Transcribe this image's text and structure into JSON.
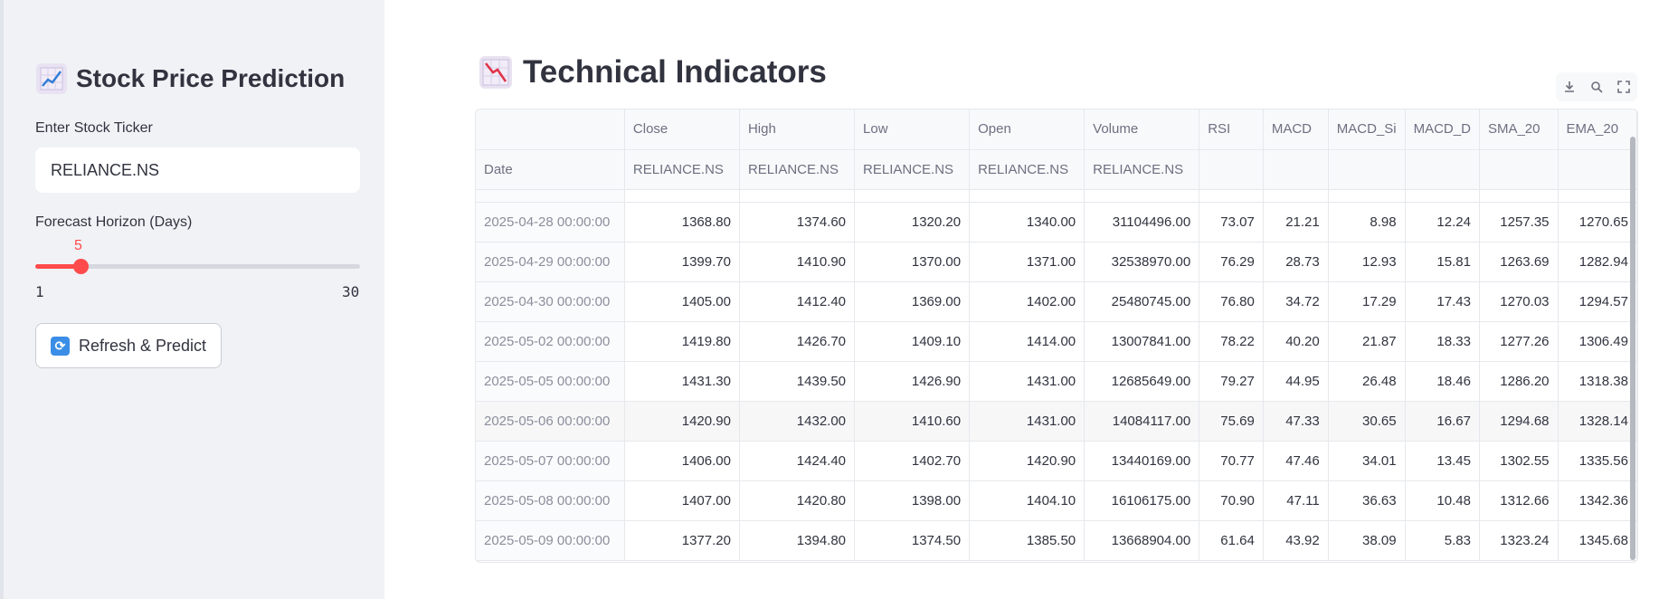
{
  "sidebar": {
    "title": "Stock Price Prediction",
    "title_icon": "chart-increasing-icon",
    "ticker_label": "Enter Stock Ticker",
    "ticker_value": "RELIANCE.NS",
    "horizon_label": "Forecast Horizon (Days)",
    "horizon_value": "5",
    "horizon_fraction": 0.138,
    "horizon_min": "1",
    "horizon_max": "30",
    "refresh_icon": "refresh-arrows-icon",
    "refresh_label": "Refresh & Predict"
  },
  "main": {
    "title": "Technical Indicators",
    "title_icon": "chart-decreasing-icon",
    "toolbar": [
      "download-icon",
      "search-icon",
      "fullscreen-icon"
    ]
  },
  "table": {
    "header_row1": [
      "",
      "Close",
      "High",
      "Low",
      "Open",
      "Volume",
      "RSI",
      "MACD",
      "MACD_Si",
      "MACD_D",
      "SMA_20",
      "EMA_20"
    ],
    "header_row2": [
      "Date",
      "RELIANCE.NS",
      "RELIANCE.NS",
      "RELIANCE.NS",
      "RELIANCE.NS",
      "RELIANCE.NS",
      "",
      "",
      "",
      "",
      "",
      ""
    ],
    "rows": [
      [
        "2025-04-28 00:00:00",
        "1368.80",
        "1374.60",
        "1320.20",
        "1340.00",
        "31104496.00",
        "73.07",
        "21.21",
        "8.98",
        "12.24",
        "1257.35",
        "1270.65"
      ],
      [
        "2025-04-29 00:00:00",
        "1399.70",
        "1410.90",
        "1370.00",
        "1371.00",
        "32538970.00",
        "76.29",
        "28.73",
        "12.93",
        "15.81",
        "1263.69",
        "1282.94"
      ],
      [
        "2025-04-30 00:00:00",
        "1405.00",
        "1412.40",
        "1369.00",
        "1402.00",
        "25480745.00",
        "76.80",
        "34.72",
        "17.29",
        "17.43",
        "1270.03",
        "1294.57"
      ],
      [
        "2025-05-02 00:00:00",
        "1419.80",
        "1426.70",
        "1409.10",
        "1414.00",
        "13007841.00",
        "78.22",
        "40.20",
        "21.87",
        "18.33",
        "1277.26",
        "1306.49"
      ],
      [
        "2025-05-05 00:00:00",
        "1431.30",
        "1439.50",
        "1426.90",
        "1431.00",
        "12685649.00",
        "79.27",
        "44.95",
        "26.48",
        "18.46",
        "1286.20",
        "1318.38"
      ],
      [
        "2025-05-06 00:00:00",
        "1420.90",
        "1432.00",
        "1410.60",
        "1431.00",
        "14084117.00",
        "75.69",
        "47.33",
        "30.65",
        "16.67",
        "1294.68",
        "1328.14"
      ],
      [
        "2025-05-07 00:00:00",
        "1406.00",
        "1424.40",
        "1402.70",
        "1420.90",
        "13440169.00",
        "70.77",
        "47.46",
        "34.01",
        "13.45",
        "1302.55",
        "1335.56"
      ],
      [
        "2025-05-08 00:00:00",
        "1407.00",
        "1420.80",
        "1398.00",
        "1404.10",
        "16106175.00",
        "70.90",
        "47.11",
        "36.63",
        "10.48",
        "1312.66",
        "1342.36"
      ],
      [
        "2025-05-09 00:00:00",
        "1377.20",
        "1394.80",
        "1374.50",
        "1385.50",
        "13668904.00",
        "61.64",
        "43.92",
        "38.09",
        "5.83",
        "1323.24",
        "1345.68"
      ]
    ]
  },
  "colors": {
    "accent": "#ff4b4b",
    "sidebar_bg": "#f0f2f6",
    "text": "#31333f"
  }
}
